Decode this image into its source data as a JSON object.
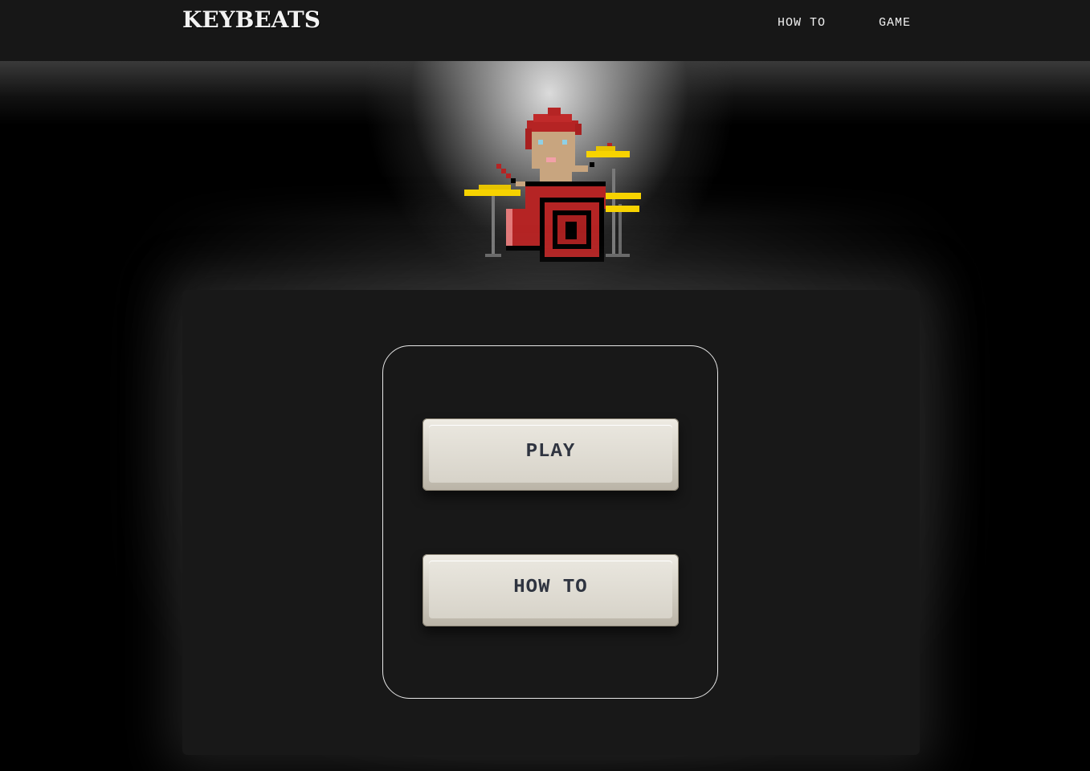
{
  "header": {
    "brand": "KEYBEATS",
    "nav": [
      {
        "label": "HOW TO"
      },
      {
        "label": "GAME"
      }
    ]
  },
  "menu": {
    "play_label": "PLAY",
    "howto_label": "HOW TO"
  },
  "icons": {
    "mascot": "pixel-drummer-icon"
  },
  "colors": {
    "background": "#000000",
    "topbar": "#171717",
    "panel": "#181818",
    "keycap": "#e4e1d8",
    "keycap_text": "#2f3440",
    "drum_red": "#b22a2a",
    "cymbal_yellow": "#f7d300",
    "hair_red": "#b52424"
  }
}
